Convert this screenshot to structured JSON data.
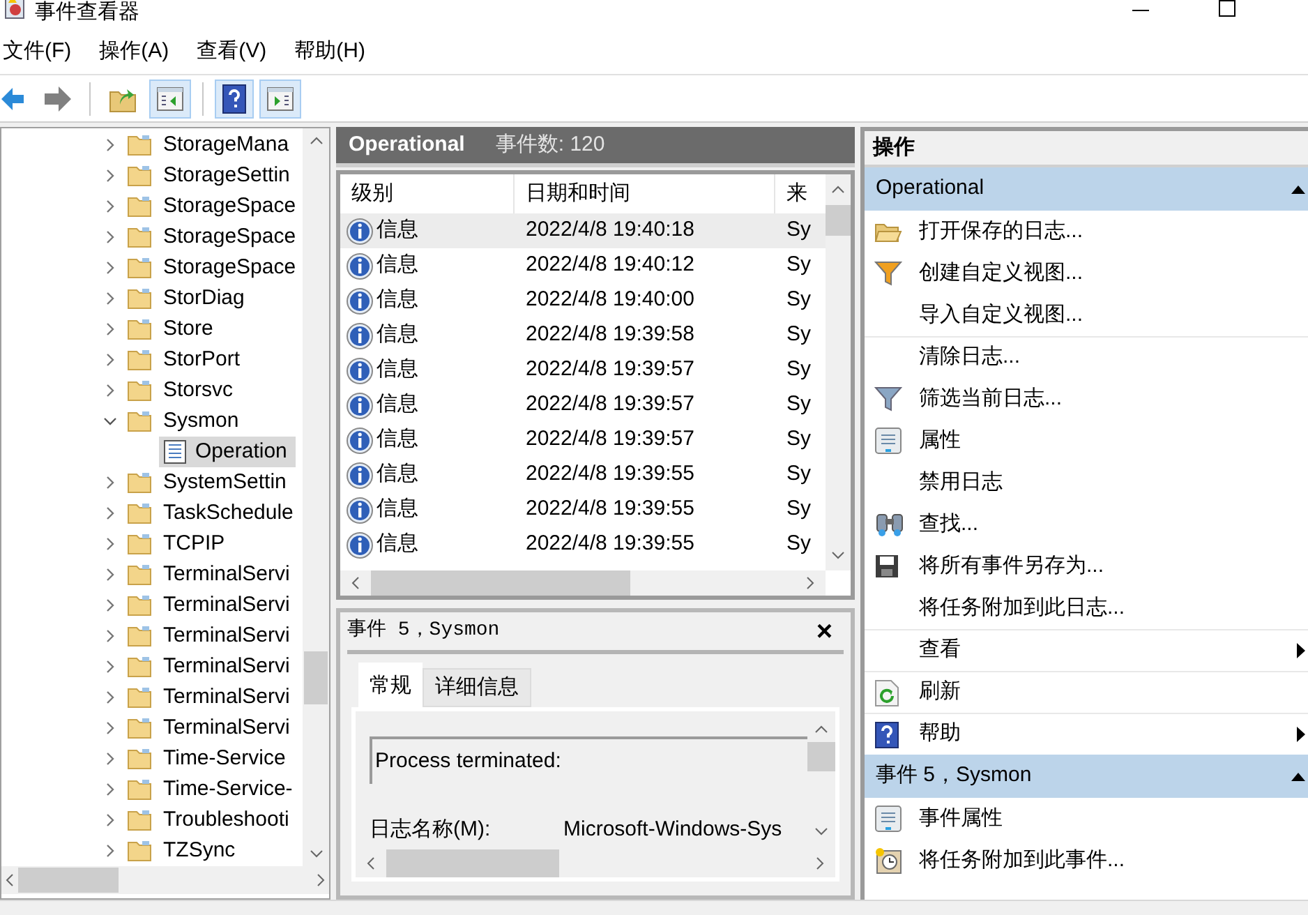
{
  "window": {
    "title": "事件查看器"
  },
  "menu": [
    "文件(F)",
    "操作(A)",
    "查看(V)",
    "帮助(H)"
  ],
  "toolbar": [
    {
      "kind": "back",
      "pressed": false
    },
    {
      "kind": "forward",
      "pressed": false
    },
    {
      "kind": "up",
      "pressed": false
    },
    {
      "kind": "tree",
      "pressed": true
    },
    {
      "kind": "help",
      "pressed": true
    },
    {
      "kind": "actions",
      "pressed": true
    }
  ],
  "tree": [
    {
      "label": "StorageMana",
      "expanded": false
    },
    {
      "label": "StorageSettin",
      "expanded": false
    },
    {
      "label": "StorageSpace",
      "expanded": false
    },
    {
      "label": "StorageSpace",
      "expanded": false
    },
    {
      "label": "StorageSpace",
      "expanded": false
    },
    {
      "label": "StorDiag",
      "expanded": false
    },
    {
      "label": "Store",
      "expanded": false
    },
    {
      "label": "StorPort",
      "expanded": false
    },
    {
      "label": "Storsvc",
      "expanded": false
    },
    {
      "label": "Sysmon",
      "expanded": true,
      "children": [
        {
          "label": "Operation",
          "kind": "log",
          "selected": true
        }
      ]
    },
    {
      "label": "SystemSettin",
      "expanded": false
    },
    {
      "label": "TaskSchedule",
      "expanded": false
    },
    {
      "label": "TCPIP",
      "expanded": false
    },
    {
      "label": "TerminalServi",
      "expanded": false
    },
    {
      "label": "TerminalServi",
      "expanded": false
    },
    {
      "label": "TerminalServi",
      "expanded": false
    },
    {
      "label": "TerminalServi",
      "expanded": false
    },
    {
      "label": "TerminalServi",
      "expanded": false
    },
    {
      "label": "TerminalServi",
      "expanded": false
    },
    {
      "label": "Time-Service",
      "expanded": false
    },
    {
      "label": "Time-Service-",
      "expanded": false
    },
    {
      "label": "Troubleshooti",
      "expanded": false
    },
    {
      "label": "TZSync",
      "expanded": false
    }
  ],
  "log": {
    "title": "Operational",
    "count": "事件数: 120",
    "columns": [
      "级别",
      "日期和时间",
      "来"
    ],
    "rows": [
      {
        "level": "信息",
        "datetime": "2022/4/8 19:40:18",
        "source": "Sy",
        "selected": true
      },
      {
        "level": "信息",
        "datetime": "2022/4/8 19:40:12",
        "source": "Sy",
        "selected": false
      },
      {
        "level": "信息",
        "datetime": "2022/4/8 19:40:00",
        "source": "Sy",
        "selected": false
      },
      {
        "level": "信息",
        "datetime": "2022/4/8 19:39:58",
        "source": "Sy",
        "selected": false
      },
      {
        "level": "信息",
        "datetime": "2022/4/8 19:39:57",
        "source": "Sy",
        "selected": false
      },
      {
        "level": "信息",
        "datetime": "2022/4/8 19:39:57",
        "source": "Sy",
        "selected": false
      },
      {
        "level": "信息",
        "datetime": "2022/4/8 19:39:57",
        "source": "Sy",
        "selected": false
      },
      {
        "level": "信息",
        "datetime": "2022/4/8 19:39:55",
        "source": "Sy",
        "selected": false
      },
      {
        "level": "信息",
        "datetime": "2022/4/8 19:39:55",
        "source": "Sy",
        "selected": false
      },
      {
        "level": "信息",
        "datetime": "2022/4/8 19:39:55",
        "source": "Sy",
        "selected": false
      }
    ]
  },
  "details": {
    "title": "事件 5，Sysmon",
    "close": "×",
    "tabs": [
      {
        "label": "常规",
        "selected": true
      },
      {
        "label": "详细信息",
        "selected": false
      }
    ],
    "message": "Process terminated:",
    "fields": [
      {
        "label": "日志名称(M):",
        "value": "Microsoft-Windows-Sys"
      }
    ]
  },
  "actions": {
    "title": "操作",
    "sections": [
      {
        "title": "Operational",
        "expanded": true,
        "items": [
          {
            "label": "打开保存的日志...",
            "kind": "open"
          },
          {
            "label": "创建自定义视图...",
            "kind": "filter_new"
          },
          {
            "label": "导入自定义视图..."
          },
          {
            "label": "清除日志...",
            "separator_before": true
          },
          {
            "label": "筛选当前日志...",
            "kind": "filter"
          },
          {
            "label": "属性",
            "kind": "properties"
          },
          {
            "label": "禁用日志"
          },
          {
            "label": "查找...",
            "kind": "find"
          },
          {
            "label": "将所有事件另存为...",
            "kind": "save"
          },
          {
            "label": "将任务附加到此日志..."
          },
          {
            "label": "查看",
            "separator_before": true,
            "submenu": true
          },
          {
            "label": "刷新",
            "kind": "refresh",
            "separator_before": true
          },
          {
            "label": "帮助",
            "kind": "help",
            "separator_before": true,
            "submenu": true
          }
        ]
      },
      {
        "title": "事件 5，Sysmon",
        "expanded": true,
        "items": [
          {
            "label": "事件属性",
            "kind": "properties"
          },
          {
            "label": "将任务附加到此事件...",
            "kind": "task"
          }
        ]
      }
    ]
  }
}
